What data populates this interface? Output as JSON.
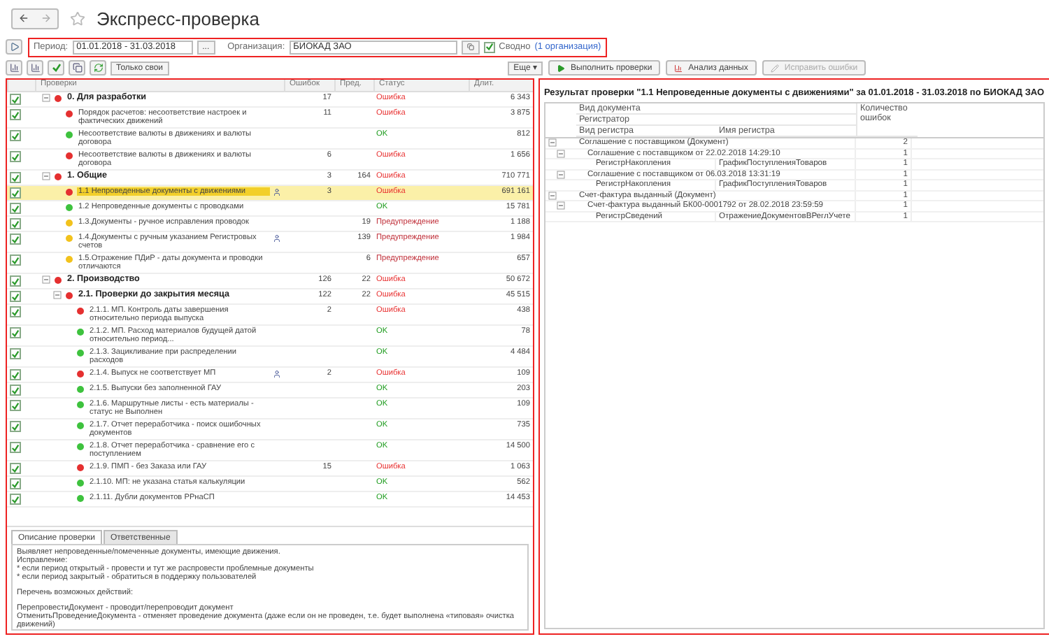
{
  "window": {
    "title": "Экспресс-проверка"
  },
  "filter": {
    "period_label": "Период:",
    "period": "01.01.2018 - 31.03.2018",
    "period_button": "...",
    "org_label": "Организация:",
    "org": "БИОКАД ЗАО",
    "summary_label": "Сводно",
    "summary_checked": true,
    "org_link": "(1 организация)"
  },
  "left_toolbar": {
    "only_mine": "Только свои",
    "more": "Еще ▾"
  },
  "right_toolbar": {
    "run": "Выполнить проверки",
    "analyze": "Анализ данных",
    "fix": "Исправить ошибки",
    "fix_disabled": true
  },
  "checks_table": {
    "columns": [
      "Проверки",
      "Ошибок",
      "Пред.",
      "Статус",
      "Длит."
    ],
    "rows": [
      {
        "title": "0. Для разработки",
        "kind": "error",
        "checked": true,
        "expanded": true,
        "selected": false,
        "responsible": false,
        "errors": "17",
        "status": "Ошибка",
        "duration": "6 343",
        "children": [
          {
            "title": "Порядок расчетов: несоответствие настроек и фактических движений",
            "kind": "error",
            "checked": true,
            "selected": false,
            "responsible": false,
            "errors": "11",
            "status": "Ошибка",
            "duration": "3 875"
          },
          {
            "title": "Несоответствие валюты в движениях и валюты договора",
            "kind": "ok",
            "checked": true,
            "selected": false,
            "responsible": false,
            "status": "OK",
            "duration": "812"
          },
          {
            "title": "Несоответствие валюты в движениях и валюты договора",
            "kind": "error",
            "checked": true,
            "selected": false,
            "responsible": false,
            "errors": "6",
            "status": "Ошибка",
            "duration": "1 656"
          }
        ]
      },
      {
        "title": "1. Общие",
        "kind": "error",
        "checked": true,
        "expanded": true,
        "selected": false,
        "responsible": false,
        "errors": "3",
        "warnings": "164",
        "status": "Ошибка",
        "duration": "710 771",
        "children": [
          {
            "title": "1.1 Непроведенные документы с движениями",
            "kind": "error",
            "checked": true,
            "selected": true,
            "responsible": true,
            "errors": "3",
            "status": "Ошибка",
            "duration": "691 161"
          },
          {
            "title": "1.2 Непроведенные документы с проводками",
            "kind": "ok",
            "checked": true,
            "selected": false,
            "responsible": false,
            "status": "OK",
            "duration": "15 781"
          },
          {
            "title": "1.3.Документы - ручное исправления проводок",
            "kind": "warning",
            "checked": true,
            "selected": false,
            "responsible": false,
            "warnings": "19",
            "status": "Предупреждение",
            "duration": "1 188"
          },
          {
            "title": "1.4.Документы с ручным указанием Регистровых счетов",
            "kind": "warning",
            "checked": true,
            "selected": false,
            "responsible": true,
            "warnings": "139",
            "status": "Предупреждение",
            "duration": "1 984"
          },
          {
            "title": "1.5.Отражение ПДиР - даты документа и проводки отличаются",
            "kind": "warning",
            "checked": true,
            "selected": false,
            "responsible": false,
            "warnings": "6",
            "status": "Предупреждение",
            "duration": "657"
          }
        ]
      },
      {
        "title": "2. Производство",
        "kind": "error",
        "checked": true,
        "expanded": true,
        "selected": false,
        "responsible": false,
        "errors": "126",
        "warnings": "22",
        "status": "Ошибка",
        "duration": "50 672",
        "children": [
          {
            "title": "2.1. Проверки до закрытия месяца",
            "kind": "error",
            "checked": true,
            "expanded": true,
            "selected": false,
            "responsible": false,
            "errors": "122",
            "warnings": "22",
            "status": "Ошибка",
            "duration": "45 515",
            "children": [
              {
                "title": "2.1.1. МП. Контроль даты завершения относительно периода выпуска",
                "kind": "error",
                "checked": true,
                "selected": false,
                "responsible": false,
                "errors": "2",
                "status": "Ошибка",
                "duration": "438"
              },
              {
                "title": "2.1.2. МП. Расход материалов будущей датой относительно период...",
                "kind": "ok",
                "checked": true,
                "selected": false,
                "responsible": false,
                "status": "OK",
                "duration": "78"
              },
              {
                "title": "2.1.3. Зацикливание при распределении расходов",
                "kind": "ok",
                "checked": true,
                "selected": false,
                "responsible": false,
                "status": "OK",
                "duration": "4 484"
              },
              {
                "title": "2.1.4. Выпуск не соответствует МП",
                "kind": "error",
                "checked": true,
                "selected": false,
                "responsible": true,
                "errors": "2",
                "status": "Ошибка",
                "duration": "109"
              },
              {
                "title": "2.1.5. Выпуски без заполненной ГАУ",
                "kind": "ok",
                "checked": true,
                "selected": false,
                "responsible": false,
                "status": "OK",
                "duration": "203"
              },
              {
                "title": "2.1.6. Маршрутные листы - есть материалы - статус не Выполнен",
                "kind": "ok",
                "checked": true,
                "selected": false,
                "responsible": false,
                "status": "OK",
                "duration": "109"
              },
              {
                "title": "2.1.7. Отчет переработчика - поиск ошибочных документов",
                "kind": "ok",
                "checked": true,
                "selected": false,
                "responsible": false,
                "status": "OK",
                "duration": "735"
              },
              {
                "title": "2.1.8. Отчет переработчика - сравнение его с поступлением",
                "kind": "ok",
                "checked": true,
                "selected": false,
                "responsible": false,
                "status": "OK",
                "duration": "14 500"
              },
              {
                "title": "2.1.9. ПМП - без Заказа или ГАУ",
                "kind": "error",
                "checked": true,
                "selected": false,
                "responsible": false,
                "errors": "15",
                "status": "Ошибка",
                "duration": "1 063"
              },
              {
                "title": "2.1.10. МП: не указана статья калькуляции",
                "kind": "ok",
                "checked": true,
                "selected": false,
                "responsible": false,
                "status": "OK",
                "duration": "562"
              },
              {
                "title": "2.1.11. Дубли документов РРнаСП",
                "kind": "ok",
                "checked": true,
                "selected": false,
                "responsible": false,
                "status": "OK",
                "duration": "14 453"
              }
            ]
          }
        ]
      }
    ]
  },
  "detail_tabs": [
    {
      "label": "Описание проверки",
      "selected": true
    },
    {
      "label": "Ответственные",
      "selected": false
    }
  ],
  "description": [
    [
      "Выявляет непроведенные/помеченные документы, имеющие движения.",
      "Исправление:",
      "* если период открытый - провести и тут же распровести проблемные документы",
      "* если период закрытый - обратиться в поддержку пользователей"
    ],
    [
      "Перечень возможных действий:"
    ],
    [
      "ПерепровестиДокумент - проводит/перепроводит документ",
      "ОтменитьПроведениеДокумента - отменяет проведение документа (даже если он не проведен, т.е. будет выполнена «типовая» очистка движений)"
    ]
  ],
  "result": {
    "title": "Результат проверки \"1.1 Непроведенные документы с движениями\" за 01.01.2018 - 31.03.2018 по БИОКАД ЗАО",
    "headers": {
      "doc_type": "Вид документа",
      "registrar": "Регистратор",
      "register_type": "Вид регистра",
      "register_name": "Имя регистра",
      "count": "Количество ошибок"
    },
    "rows": [
      {
        "label": "Соглашение с поставщиком (Документ)",
        "count": "2",
        "expanded": true,
        "children": [
          {
            "label": "Соглашение с поставщиком от 22.02.2018 14:29:10",
            "count": "1",
            "expanded": true,
            "children": [
              {
                "label": "РегистрНакопления",
                "register": "ГрафикПоступленияТоваров",
                "count": "1"
              }
            ]
          },
          {
            "label": "Соглашение с поставщиком от 06.03.2018 13:31:19",
            "count": "1",
            "expanded": true,
            "children": [
              {
                "label": "РегистрНакопления",
                "register": "ГрафикПоступленияТоваров",
                "count": "1"
              }
            ]
          }
        ]
      },
      {
        "label": "Счет-фактура выданный (Документ)",
        "count": "1",
        "expanded": true,
        "children": [
          {
            "label": "Счет-фактура выданный БК00-0001792 от 28.02.2018 23:59:59",
            "count": "1",
            "expanded": true,
            "children": [
              {
                "label": "РегистрСведений",
                "register": "ОтражениеДокументовВРеглУчете",
                "count": "1"
              }
            ]
          }
        ]
      }
    ]
  }
}
